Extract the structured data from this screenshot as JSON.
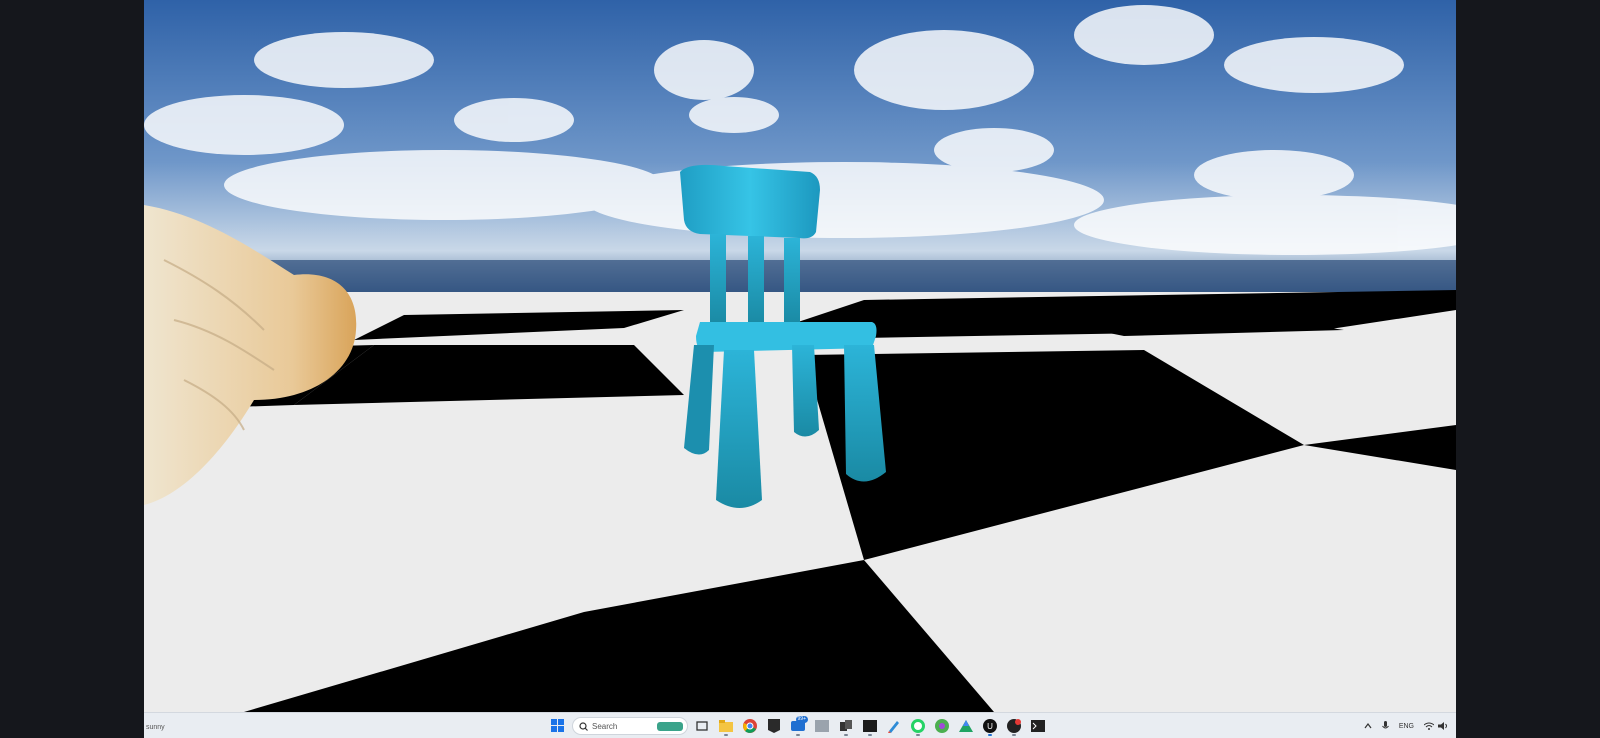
{
  "viewport": {
    "sky_top": "#2c5fa6",
    "sky_horizon": "#dbe6f0",
    "floor_dark": "#000000",
    "floor_light": "#ededed",
    "chair_color": "#29b5da"
  },
  "taskbar": {
    "weather_text": "sunny",
    "search_placeholder": "Search",
    "notification_badge": "99+",
    "language": "ENG"
  },
  "icons": {
    "start": "windows-start-icon",
    "search": "search-icon",
    "apps": [
      "task-view-icon",
      "file-explorer-icon",
      "chrome-icon",
      "epic-games-icon",
      "chat-icon",
      "photos-icon",
      "folder-app-icon",
      "terminal-window-icon",
      "pen-app-icon",
      "whatsapp-icon",
      "chrome-profile-icon",
      "drive-icon",
      "unreal-engine-icon",
      "davinci-icon",
      "command-prompt-icon"
    ],
    "tray": [
      "chevron-up-icon",
      "microphone-icon",
      "wifi-icon",
      "volume-icon"
    ]
  }
}
